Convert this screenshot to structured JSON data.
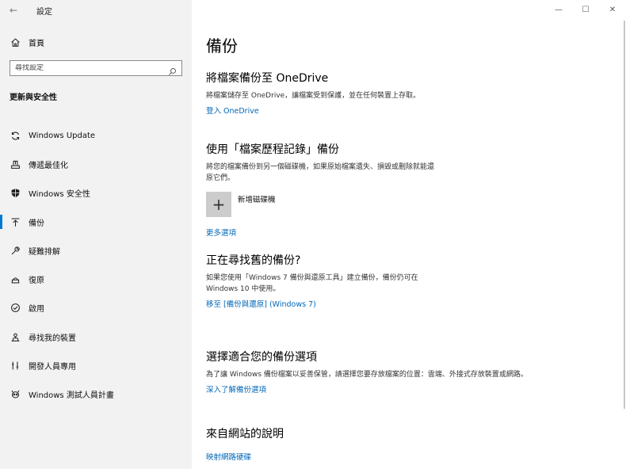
{
  "titlebar": {
    "back_glyph": "←",
    "app_title": "設定",
    "minimize": "—",
    "maximize": "☐",
    "close": "✕"
  },
  "sidebar": {
    "home_label": "首頁",
    "search_placeholder": "尋找設定",
    "section_title": "更新與安全性",
    "items": [
      {
        "label": "Windows Update",
        "icon": "refresh-icon"
      },
      {
        "label": "傳遞最佳化",
        "icon": "delivery-optimization-icon"
      },
      {
        "label": "Windows 安全性",
        "icon": "shield-icon"
      },
      {
        "label": "備份",
        "icon": "backup-arrow-icon",
        "active": true
      },
      {
        "label": "疑難排解",
        "icon": "wrench-icon"
      },
      {
        "label": "復原",
        "icon": "recovery-icon"
      },
      {
        "label": "啟用",
        "icon": "check-circle-icon"
      },
      {
        "label": "尋找我的裝置",
        "icon": "find-device-icon"
      },
      {
        "label": "開發人員專用",
        "icon": "developer-icon"
      },
      {
        "label": "Windows 測試人員計畫",
        "icon": "insider-icon"
      }
    ]
  },
  "main": {
    "page_title": "備份",
    "onedrive": {
      "title": "將檔案備份至 OneDrive",
      "desc": "將檔案儲存至 OneDrive，讓檔案受到保護，並在任何裝置上存取。",
      "link": "登入 OneDrive"
    },
    "file_history": {
      "title": "使用「檔案歷程記錄」備份",
      "desc_line1": "將您的檔案備份到另一個磁碟機，如果原始檔案遺失、損毀或刪除就能還",
      "desc_line2": "原它們。",
      "add_drive": "新增磁碟機",
      "plus_glyph": "+",
      "more_options": "更多選項"
    },
    "old_backup": {
      "title": "正在尋找舊的備份?",
      "desc_line1": "如果您使用「Windows 7 備份與還原工具」建立備份，備份仍可在",
      "desc_line2": "Windows 10 中使用。",
      "link": "移至 [備份與還原] (Windows 7)"
    },
    "choose": {
      "title": "選擇適合您的備份選項",
      "desc": "為了讓 Windows 備份檔案以妥善保管，請選擇您要存放檔案的位置：雲端、外接式存放裝置或網路。",
      "link": "深入了解備份選項"
    },
    "web_help": {
      "title": "來自網站的說明",
      "link": "映射網路硬碟"
    }
  },
  "colors": {
    "accent": "#0078d4",
    "link": "#0067b8",
    "sidebar_bg": "#f2f2f2"
  }
}
